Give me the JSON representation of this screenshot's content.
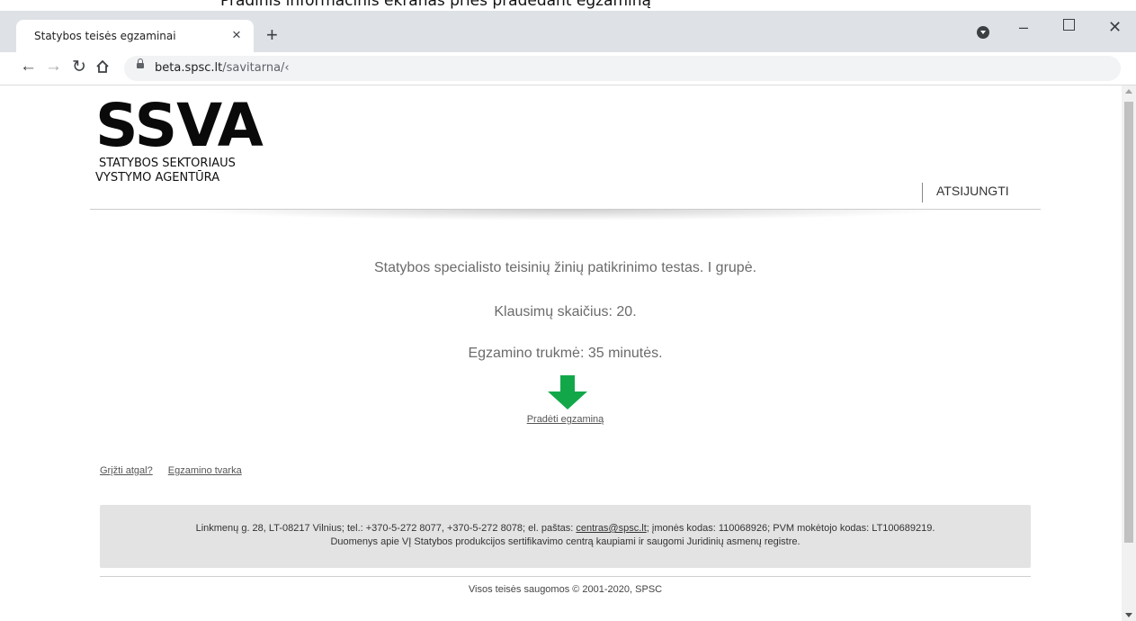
{
  "caption": "Pradinis informacinis ekranas prieš pradedant egzaminą",
  "browser": {
    "tab_title": "Statybos teisės egzaminai",
    "tab_close": "×",
    "new_tab": "+",
    "window_min": "–",
    "window_close": "✕",
    "url_host": "beta.spsc.lt",
    "url_path": "/savitarna/‹"
  },
  "header": {
    "logo_mark": "SSVA",
    "logo_line1": "STATYBOS SEKTORIAUS",
    "logo_line2": "VYSTYMO AGENTŪRA",
    "logout": "ATSIJUNGTI"
  },
  "exam": {
    "title": "Statybos specialisto teisinių žinių patikrinimo testas. I grupė.",
    "questions": "Klausimų skaičius: 20.",
    "duration": "Egzamino trukmė: 35 minutės.",
    "start_link": "Pradėti egzaminą"
  },
  "links": {
    "back": "Grįžti atgal?",
    "rules": "Egzamino tvarka"
  },
  "footer": {
    "line1_pre": "Linkmenų g. 28, LT-08217 Vilnius; tel.: +370-5-272 8077, +370-5-272 8078; el. paštas: ",
    "email": "centras@spsc.lt",
    "line1_post": "; įmonės kodas: 110068926; PVM mokėtojo kodas: LT100689219.",
    "line2": "Duomenys apie VĮ Statybos produkcijos sertifikavimo centrą kaupiami ir saugomi Juridinių asmenų registre.",
    "copyright": "Visos teisės saugomos © 2001-2020, SPSC"
  },
  "colors": {
    "arrow": "#12a84a",
    "tabbar": "#dee1e6"
  },
  "icons": [
    "back-arrow-icon",
    "forward-arrow-icon",
    "reload-icon",
    "home-icon",
    "lock-icon",
    "profile-icon",
    "down-arrow-icon"
  ]
}
